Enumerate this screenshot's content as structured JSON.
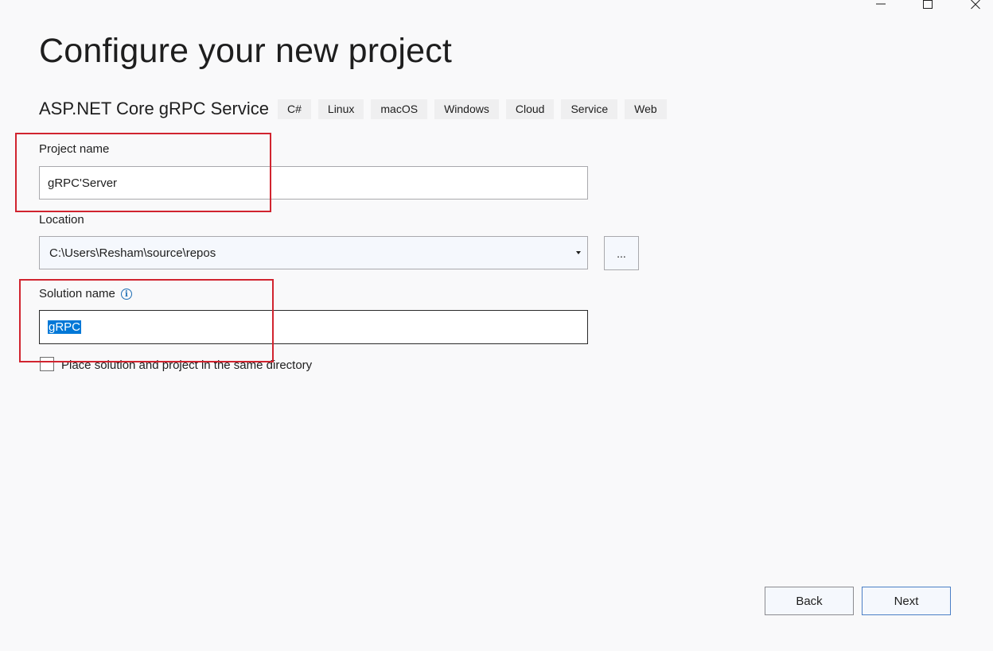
{
  "window": {
    "minimize_label": "minimize",
    "maximize_label": "maximize",
    "close_label": "close"
  },
  "page": {
    "title": "Configure your new project"
  },
  "template": {
    "name": "ASP.NET Core gRPC Service",
    "tags": [
      "C#",
      "Linux",
      "macOS",
      "Windows",
      "Cloud",
      "Service",
      "Web"
    ]
  },
  "project_name": {
    "label": "Project name",
    "value": "gRPC'Server"
  },
  "location": {
    "label": "Location",
    "value": "C:\\Users\\Resham\\source\\repos",
    "browse_label": "..."
  },
  "solution_name": {
    "label": "Solution name",
    "value": "gRPC",
    "info_glyph": "i"
  },
  "same_directory": {
    "label": "Place solution and project in the same directory",
    "checked": false
  },
  "footer": {
    "back_label": "Back",
    "next_label": "Next"
  },
  "colors": {
    "accent": "#0078d7",
    "annotation_red": "#d1242f",
    "info_blue": "#1f6fb5",
    "background": "#f9f9fa"
  }
}
